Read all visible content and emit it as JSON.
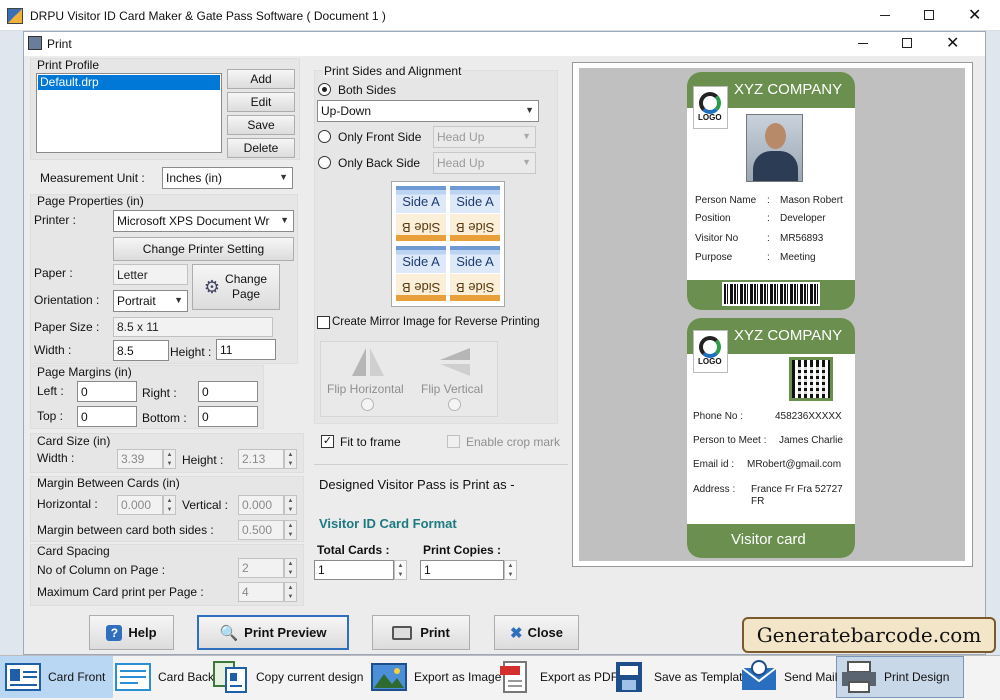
{
  "app": {
    "title": "DRPU Visitor ID Card Maker & Gate Pass Software ( Document 1 )"
  },
  "dialog": {
    "title": "Print"
  },
  "profile": {
    "group": "Print Profile",
    "items": [
      "Default.drp"
    ],
    "add": "Add",
    "edit": "Edit",
    "save": "Save",
    "delete": "Delete"
  },
  "measure": {
    "label": "Measurement Unit :",
    "value": "Inches (in)"
  },
  "page": {
    "group": "Page Properties (in)",
    "printer_label": "Printer :",
    "printer": "Microsoft XPS Document Wr",
    "change_printer": "Change Printer Setting",
    "paper_label": "Paper :",
    "paper": "Letter",
    "change_page": "Change Page",
    "orientation_label": "Orientation :",
    "orientation": "Portrait",
    "size_label": "Paper Size :",
    "size": "8.5 x 11",
    "width_label": "Width :",
    "width": "8.5",
    "height_label": "Height :",
    "height": "11"
  },
  "margins": {
    "group": "Page Margins (in)",
    "left_label": "Left :",
    "left": "0",
    "right_label": "Right :",
    "right": "0",
    "top_label": "Top :",
    "top": "0",
    "bottom_label": "Bottom :",
    "bottom": "0"
  },
  "cardsize": {
    "group": "Card Size (in)",
    "width_label": "Width :",
    "width": "3.39",
    "height_label": "Height :",
    "height": "2.13"
  },
  "between": {
    "group": "Margin Between Cards (in)",
    "h_label": "Horizontal :",
    "h": "0.000",
    "v_label": "Vertical :",
    "v": "0.000",
    "both_label": "Margin between card both sides :",
    "both": "0.500"
  },
  "spacing": {
    "group": "Card Spacing",
    "cols_label": "No of Column on Page :",
    "cols": "2",
    "max_label": "Maximum Card print per Page :",
    "max": "4"
  },
  "sides": {
    "group": "Print Sides and Alignment",
    "both": "Both Sides",
    "both_align": "Up-Down",
    "front": "Only Front Side",
    "front_align": "Head Up",
    "back": "Only Back Side",
    "back_align": "Head Up",
    "tile_a": "Side A",
    "tile_b": "Side B",
    "mirror": "Create Mirror Image for Reverse Printing",
    "flip_h": "Flip Horizontal",
    "flip_v": "Flip Vertical",
    "fit": "Fit to frame",
    "crop": "Enable crop mark"
  },
  "format": {
    "text": "Designed Visitor Pass is Print as -",
    "name": "Visitor ID Card Format"
  },
  "totals": {
    "cards_label": "Total Cards :",
    "cards": "1",
    "copies_label": "Print Copies :",
    "copies": "1"
  },
  "card": {
    "company": "XYZ COMPANY",
    "logo": "LOGO",
    "rows": [
      {
        "k": "Person Name",
        "v": "Mason Robert"
      },
      {
        "k": "Position",
        "v": "Developer"
      },
      {
        "k": "Visitor No",
        "v": "MR56893"
      },
      {
        "k": "Purpose",
        "v": "Meeting"
      }
    ],
    "back_rows": [
      {
        "k": "Phone No :",
        "v": "458236XXXXX"
      },
      {
        "k": "Person to Meet :",
        "v": "James Charlie"
      },
      {
        "k": "Email id :",
        "v": "MRobert@gmail.com"
      },
      {
        "k": "Address :",
        "v": "France Fr Fra 52727 FR"
      }
    ],
    "footer": "Visitor card"
  },
  "actions": {
    "help": "Help",
    "preview": "Print Preview",
    "print": "Print",
    "close": "Close"
  },
  "brand": "Generatebarcode.com",
  "toolbar": [
    "Card Front",
    "Card Back",
    "Copy current design",
    "Export as Image",
    "Export as PDF",
    "Save as Template",
    "Send Mail",
    "Print Design"
  ],
  "colors": {
    "green": "#6b8f4e",
    "accent_blue": "#1f5fa8",
    "format_teal": "#1c7a80"
  }
}
